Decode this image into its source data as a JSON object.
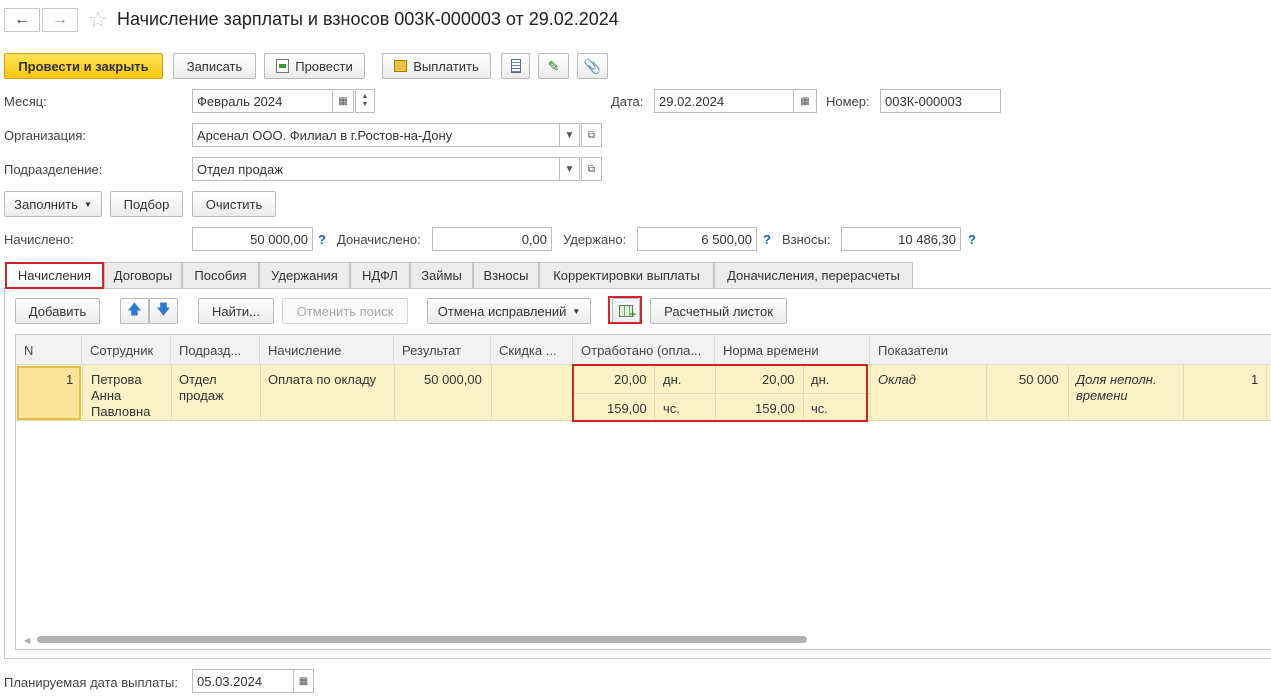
{
  "title": "Начисление зарплаты и взносов 003К-000003 от 29.02.2024",
  "toolbar": {
    "post_close": "Провести и закрыть",
    "save": "Записать",
    "post": "Провести",
    "pay": "Выплатить"
  },
  "form": {
    "month_label": "Месяц:",
    "month_value": "Февраль 2024",
    "date_label": "Дата:",
    "date_value": "29.02.2024",
    "number_label": "Номер:",
    "number_value": "003К-000003",
    "org_label": "Организация:",
    "org_value": "Арсенал ООО. Филиал в г.Ростов-на-Дону",
    "dept_label": "Подразделение:",
    "dept_value": "Отдел продаж"
  },
  "actions": {
    "fill": "Заполнить",
    "select": "Подбор",
    "clear": "Очистить"
  },
  "totals": {
    "accrued_label": "Начислено:",
    "accrued_value": "50 000,00",
    "additional_label": "Доначислено:",
    "additional_value": "0,00",
    "withheld_label": "Удержано:",
    "withheld_value": "6 500,00",
    "contrib_label": "Взносы:",
    "contrib_value": "10 486,30",
    "q": "?"
  },
  "tabs": [
    "Начисления",
    "Договоры",
    "Пособия",
    "Удержания",
    "НДФЛ",
    "Займы",
    "Взносы",
    "Корректировки выплаты",
    "Доначисления, перерасчеты"
  ],
  "grid_toolbar": {
    "add": "Добавить",
    "find": "Найти...",
    "cancel_search": "Отменить поиск",
    "cancel_corrections": "Отмена исправлений",
    "payslip": "Расчетный листок"
  },
  "columns": [
    "N",
    "Сотрудник",
    "Подразд...",
    "Начисление",
    "Результат",
    "Скидка ...",
    "Отработано (опла...",
    "Норма времени",
    "Показатели"
  ],
  "row": {
    "n": "1",
    "employee_1": "Петрова",
    "employee_2": "Анна",
    "employee_3": "Павловна",
    "dept_1": "Отдел",
    "dept_2": "продаж",
    "accrual": "Оплата по окладу",
    "result": "50 000,00",
    "worked_days": "20,00",
    "days_unit": "дн.",
    "worked_hours": "159,00",
    "hours_unit": "чс.",
    "norm_days": "20,00",
    "norm_hours": "159,00",
    "ind1_name": "Оклад",
    "ind1_value": "50 000",
    "ind2_name_1": "Доля неполн.",
    "ind2_name_2": "времени",
    "ind2_value": "1"
  },
  "footer": {
    "pay_date_label": "Планируемая дата выплаты:",
    "pay_date_value": "05.03.2024"
  },
  "colors": {
    "accent_yellow": "#f7c70d",
    "highlight_red": "#d2232a",
    "selected_row": "#fcf2c7",
    "link_blue": "#1c62b9"
  }
}
